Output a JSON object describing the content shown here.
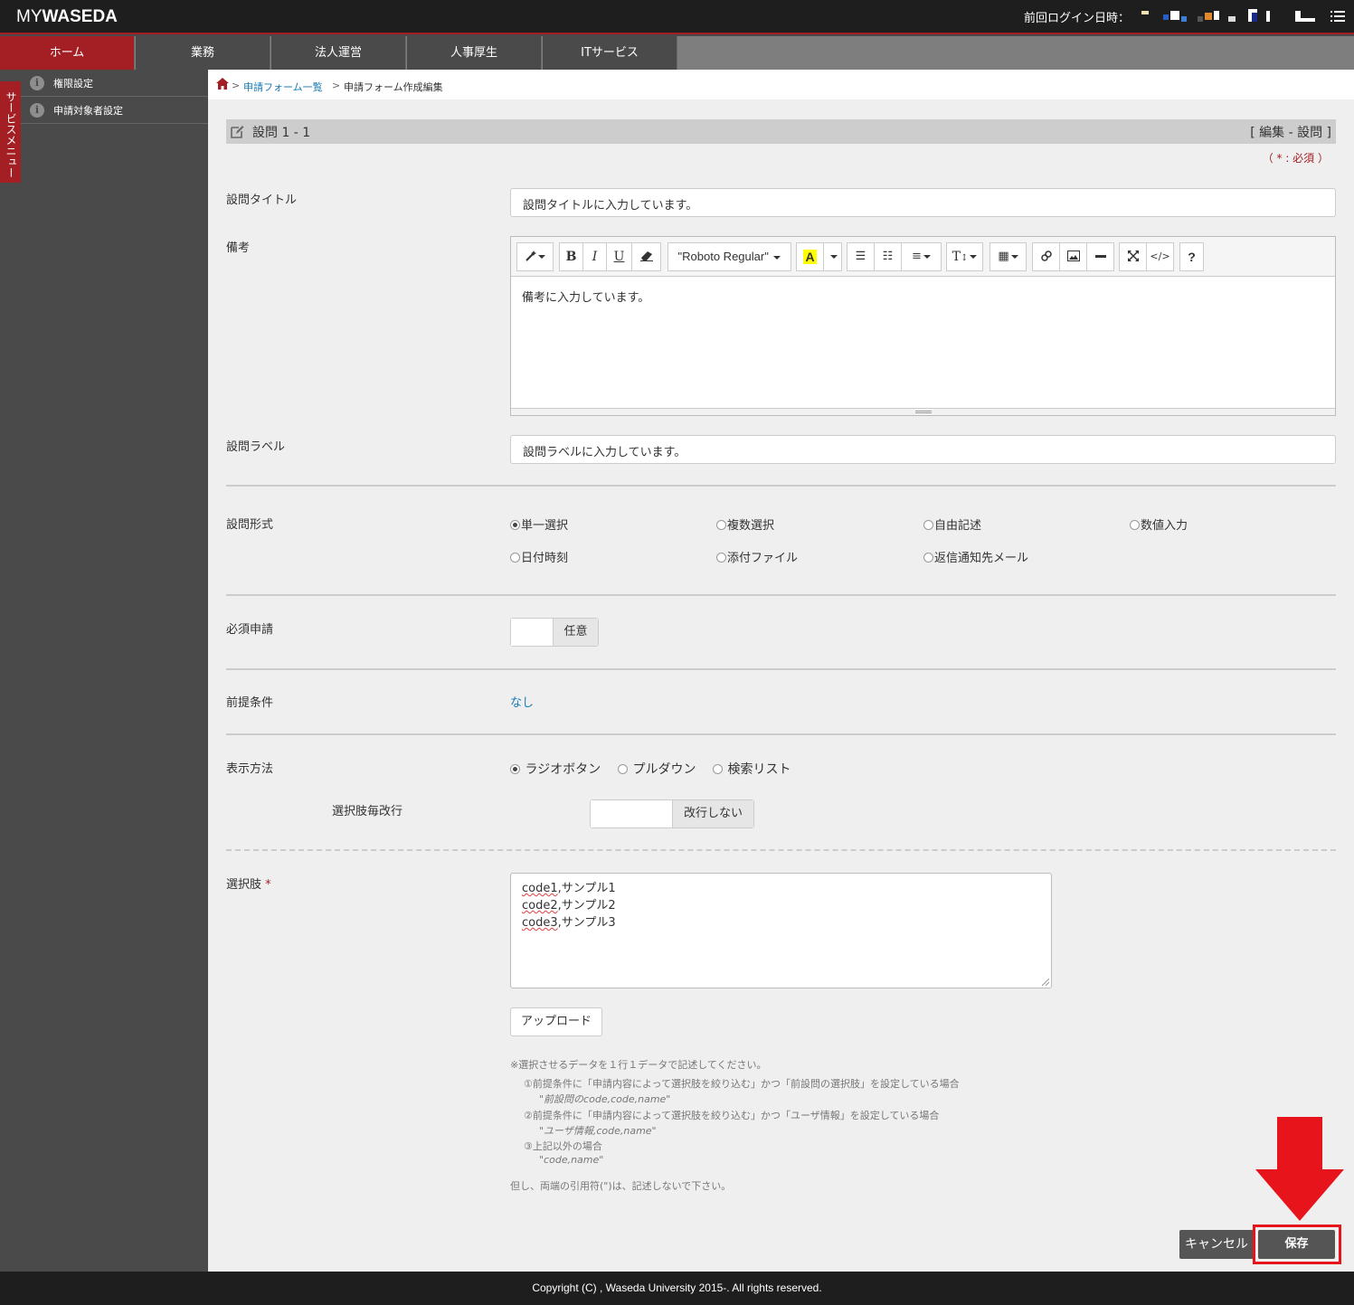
{
  "header": {
    "logo_my": "MY",
    "logo_waseda": "WASEDA",
    "last_login_label": "前回ログイン日時："
  },
  "nav": {
    "tabs": [
      {
        "label": "ホーム"
      },
      {
        "label": "業務"
      },
      {
        "label": "法人運営"
      },
      {
        "label": "人事厚生"
      },
      {
        "label": "ITサービス"
      }
    ]
  },
  "sidebar": {
    "items": [
      {
        "label": "権限設定"
      },
      {
        "label": "申請対象者設定"
      }
    ],
    "service_menu": "サービスメニュー"
  },
  "breadcrumb": {
    "sep": ">",
    "form_list": "申請フォーム一覧",
    "current": "申請フォーム作成編集"
  },
  "question": {
    "title": "設問 1 - 1",
    "mode": "[ 編集 - 設問 ]",
    "required_note": "（ * : 必須 ）"
  },
  "fields": {
    "title_label": "設問タイトル",
    "title_value": "設問タイトルに入力しています。",
    "note_label": "備考",
    "note_value": "備考に入力しています。",
    "q_label_label": "設問ラベル",
    "q_label_value": "設問ラベルに入力しています。",
    "format_label": "設問形式",
    "required_label": "必須申請",
    "required_state": "任意",
    "precondition_label": "前提条件",
    "precondition_value": "なし",
    "display_label": "表示方法",
    "linebreak_label": "選択肢毎改行",
    "linebreak_state": "改行しない",
    "choices_label": "選択肢",
    "required_mark": "*",
    "choices_lines": [
      {
        "code": "code1",
        "text": ",サンプル1"
      },
      {
        "code": "code2",
        "text": ",サンプル2"
      },
      {
        "code": "code3",
        "text": ",サンプル3"
      }
    ],
    "upload_button": "アップロード"
  },
  "editor_toolbar": {
    "font_name": "\"Roboto Regular\"",
    "bold": "B",
    "italic": "I",
    "underline": "U",
    "text_size": "T",
    "help": "?"
  },
  "format_options": [
    {
      "label": "単一選択",
      "checked": true
    },
    {
      "label": "複数選択",
      "checked": false
    },
    {
      "label": "自由記述",
      "checked": false
    },
    {
      "label": "数値入力",
      "checked": false
    },
    {
      "label": "日付時刻",
      "checked": false
    },
    {
      "label": "添付ファイル",
      "checked": false
    },
    {
      "label": "返信通知先メール",
      "checked": false
    }
  ],
  "display_options": [
    {
      "label": "ラジオボタン",
      "checked": true
    },
    {
      "label": "プルダウン",
      "checked": false
    },
    {
      "label": "検索リスト",
      "checked": false
    }
  ],
  "help_text": {
    "line1": "※選択させるデータを１行１データで記述してください。",
    "line2": "①前提条件に「申請内容によって選択肢を絞り込む」かつ「前設問の選択肢」を設定している場合",
    "line3": "\"前設問のcode,code,name\"",
    "line4": "②前提条件に「申請内容によって選択肢を絞り込む」かつ「ユーザ情報」を設定している場合",
    "line5": "\"ユーザ情報,code,name\"",
    "line6": "③上記以外の場合",
    "line7": "\"code,name\"",
    "line8": "但し、両端の引用符(\")は、記述しないで下さい。"
  },
  "actions": {
    "cancel": "キャンセル",
    "save": "保存"
  },
  "footer": {
    "copyright": "Copyright (C) , Waseda University 2015-. All rights reserved."
  },
  "colors": {
    "brand_red": "#a31f24",
    "header_black": "#1e1e1e",
    "sidebar_gray": "#4a4a4a",
    "link_blue": "#1a7ab5",
    "highlight_red": "#e8141c"
  }
}
